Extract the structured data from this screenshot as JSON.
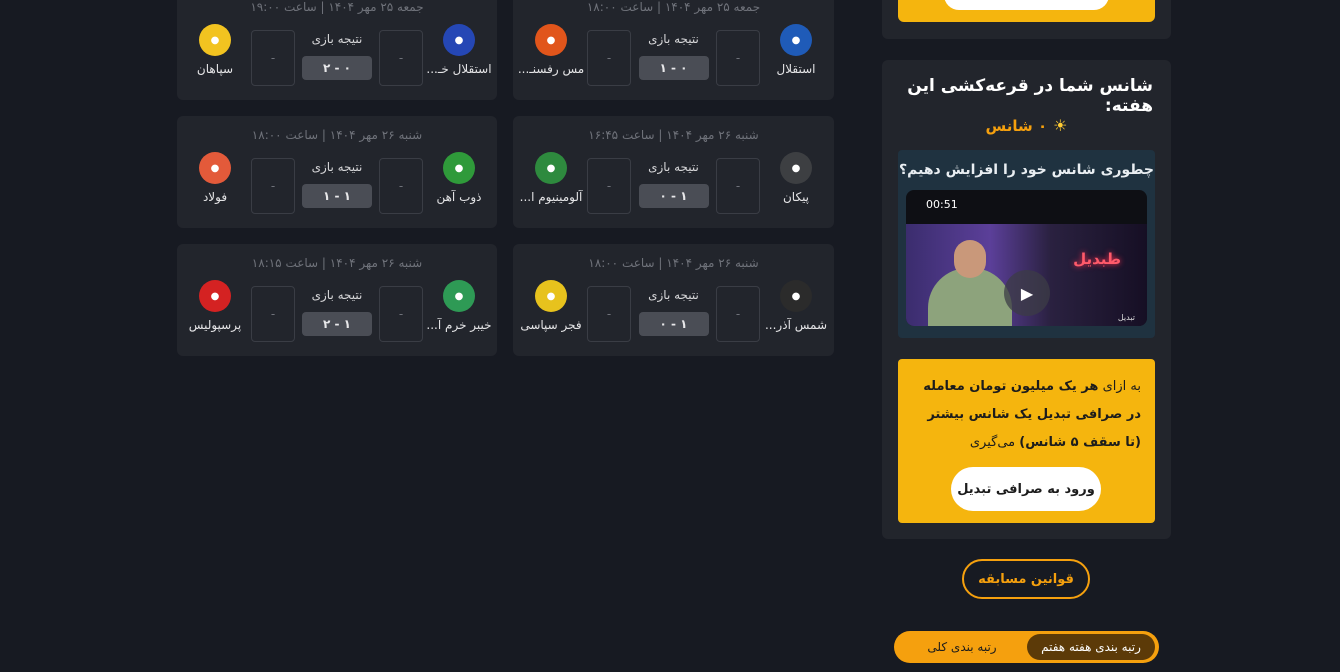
{
  "matches_labels": {
    "result_label": "نتیجه بازی",
    "empty_prediction": "-"
  },
  "matches": [
    {
      "date": "جمعه ۲۵ مهر ۱۴۰۴ | ساعت ۱۸:۰۰",
      "home": "استقلال",
      "away": "مس رفسنـ...",
      "score": "۱ - ۰",
      "home_color": "#1f5bb8",
      "away_color": "#e1551b",
      "home_icon": "esteghlal-logo",
      "away_icon": "mes-rafsanjan-logo"
    },
    {
      "date": "جمعه ۲۵ مهر ۱۴۰۴ | ساعت ۱۹:۰۰",
      "home": "استقلال خـ...",
      "away": "سپاهان",
      "score": "۲ - ۰",
      "home_color": "#2547b5",
      "away_color": "#f2c320",
      "home_icon": "esteghlal-khuzestan-logo",
      "away_icon": "sepahan-logo"
    },
    {
      "date": "شنبه ۲۶ مهر ۱۴۰۴ | ساعت ۱۶:۴۵",
      "home": "پیکان",
      "away": "آلومینیوم ا...",
      "score": "۰ - ۱",
      "home_color": "#3d3f42",
      "away_color": "#2e8a3e",
      "home_icon": "paykan-logo",
      "away_icon": "aluminium-arak-logo"
    },
    {
      "date": "شنبه ۲۶ مهر ۱۴۰۴ | ساعت ۱۸:۰۰",
      "home": "ذوب آهن",
      "away": "فولاد",
      "score": "۱ - ۱",
      "home_color": "#2f9a3a",
      "away_color": "#e35a3a",
      "home_icon": "zob-ahan-logo",
      "away_icon": "foolad-logo"
    },
    {
      "date": "شنبه ۲۶ مهر ۱۴۰۴ | ساعت ۱۸:۰۰",
      "home": "شمس آذر...",
      "away": "فجر سپاسی",
      "score": "۰ - ۱",
      "home_color": "#2b2b2b",
      "away_color": "#e7c21d",
      "home_icon": "shams-azar-logo",
      "away_icon": "fajr-sepasi-logo"
    },
    {
      "date": "شنبه ۲۶ مهر ۱۴۰۴ | ساعت ۱۸:۱۵",
      "home": "خیبر خرم آ...",
      "away": "پرسپولیس",
      "score": "۲ - ۱",
      "home_color": "#2e9a55",
      "away_color": "#d42222",
      "home_icon": "kheybar-logo",
      "away_icon": "persepolis-logo"
    }
  ],
  "sidebar": {
    "title": "شانس شما در قرعه‌کشی این هفته:",
    "chance_value": "۰ شانس",
    "chance_icon": "sun-icon",
    "video": {
      "title": "چطوری شانس خود را افزایش دهیم؟",
      "duration": "00:51",
      "neon_text": "طبدیل",
      "brand": "تبدیل"
    },
    "promo": {
      "text_prefix": "به ازای",
      "text_bold": "هر یک میلیون تومان معامله در صرافی تبدیل یک شانس بیشتر (تا سقف ۵ شانس)",
      "text_suffix": "می‌گیری",
      "cta_label": "ورود به صرافی تبدیل"
    },
    "rules_label": "قوانین مسابقه",
    "ranking_tabs": {
      "active": "رتبه بندی هفته هفتم",
      "inactive": "رتبه بندی کلی"
    }
  },
  "colors": {
    "accent": "#f5b50e",
    "orange": "#f5a00e",
    "background": "#171a22",
    "card": "#22252c"
  }
}
